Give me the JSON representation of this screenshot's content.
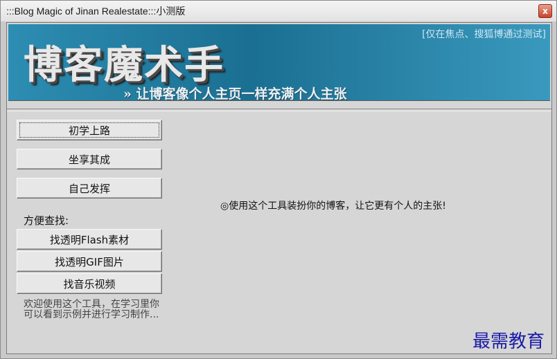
{
  "window": {
    "title": ":::Blog Magic of Jinan Realestate:::小测版",
    "close_label": "x"
  },
  "banner": {
    "title": "博客魔术手",
    "slogan": "» 让博客像个人主页一样充满个人主张",
    "note": "[仅在焦点、搜狐博通过测试]"
  },
  "buttons": {
    "beginner": "初学上路",
    "ready_made": "坐享其成",
    "diy": "自己发挥"
  },
  "find": {
    "label": "方便查找:",
    "flash": "找透明Flash素材",
    "gif": "找透明GIF图片",
    "music": "找音乐视频"
  },
  "welcome_text": "欢迎使用这个工具，在学习里你可以看到示例并进行学习制作...",
  "center_message": "◎使用这个工具装扮你的博客，让它更有个人的主张!",
  "watermark": "最需教育",
  "colors": {
    "banner": "#1a6f92",
    "watermark": "#1a1aa8"
  }
}
